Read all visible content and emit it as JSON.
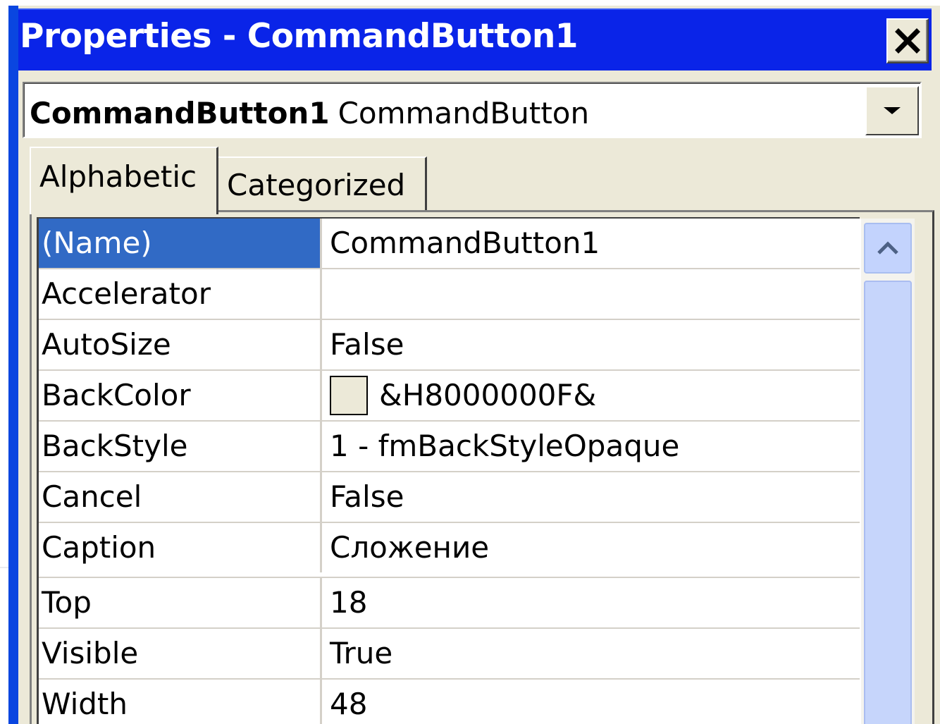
{
  "window": {
    "title": "Properties - CommandButton1"
  },
  "object_selector": {
    "name": "CommandButton1",
    "type": "CommandButton"
  },
  "tabs": [
    {
      "label": "Alphabetic",
      "active": true
    },
    {
      "label": "Categorized",
      "active": false
    }
  ],
  "properties": [
    {
      "name": "(Name)",
      "value": "CommandButton1",
      "selected": true
    },
    {
      "name": "Accelerator",
      "value": ""
    },
    {
      "name": "AutoSize",
      "value": "False"
    },
    {
      "name": "BackColor",
      "value": "&H8000000F&",
      "swatch": "#ece9d8"
    },
    {
      "name": "BackStyle",
      "value": "1 - fmBackStyleOpaque"
    },
    {
      "name": "Cancel",
      "value": "False"
    },
    {
      "name": "Caption",
      "value": "Сложение"
    },
    {
      "name": "Top",
      "value": "18"
    },
    {
      "name": "Visible",
      "value": "True"
    },
    {
      "name": "Width",
      "value": "48"
    }
  ],
  "icons": {
    "close": "close-icon",
    "dropdown": "chevron-down-icon",
    "scroll_up": "chevron-up-icon"
  },
  "colors": {
    "titlebar": "#0a24e8",
    "selection": "#316ac5",
    "face": "#ece9d8"
  }
}
